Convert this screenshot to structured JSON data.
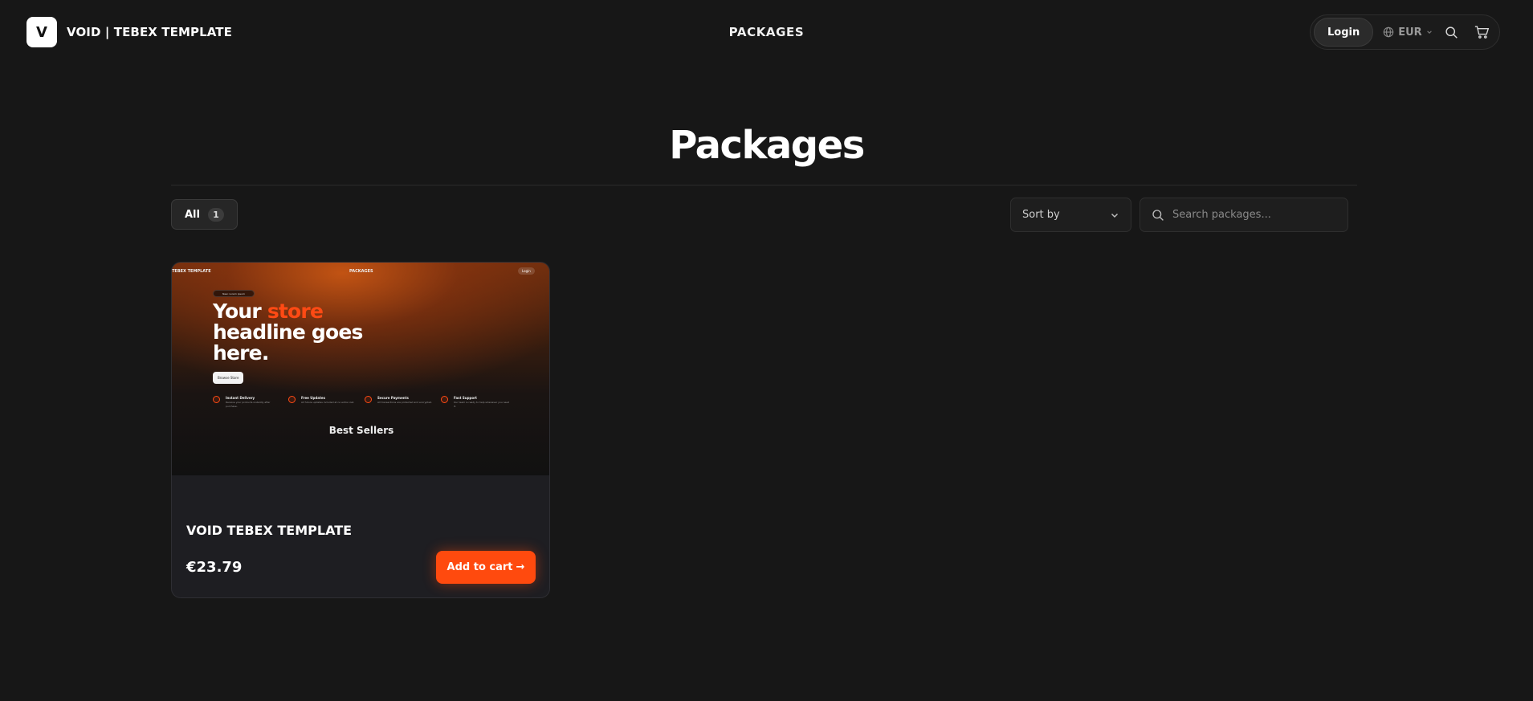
{
  "header": {
    "logo_letter": "V",
    "brand_name": "VOID | TEBEX TEMPLATE",
    "nav_link": "PACKAGES",
    "login_label": "Login",
    "currency": "EUR"
  },
  "page": {
    "title": "Packages"
  },
  "filters": {
    "tab_all_label": "All",
    "tab_all_count": "1",
    "sort_label": "Sort by",
    "search_placeholder": "Search packages..."
  },
  "card": {
    "thumbnail": {
      "brand": "TEBEX TEMPLATE",
      "nav": "PACKAGES",
      "login": "Login",
      "pill": "New: Lorem ipsum",
      "headline_part1": "Your ",
      "headline_accent": "store",
      "headline_part2": "headline goes",
      "headline_part3": "here.",
      "cta": "Browse Store",
      "features": [
        {
          "title": "Instant Delivery",
          "desc": "Receive your products instantly after purchase."
        },
        {
          "title": "Free Updates",
          "desc": "All future updates included at no extra cost."
        },
        {
          "title": "Secure Payments",
          "desc": "All transactions are protected and encrypted."
        },
        {
          "title": "Fast Support",
          "desc": "Our team is ready to help whenever you need it."
        }
      ],
      "section_title": "Best Sellers"
    },
    "title": "VOID TEBEX TEMPLATE",
    "price": "€23.79",
    "add_to_cart_label": "Add to cart",
    "add_to_cart_arrow": "→"
  },
  "colors": {
    "accent": "#ff4a0e",
    "background": "#171717",
    "card": "#1e1e22"
  }
}
